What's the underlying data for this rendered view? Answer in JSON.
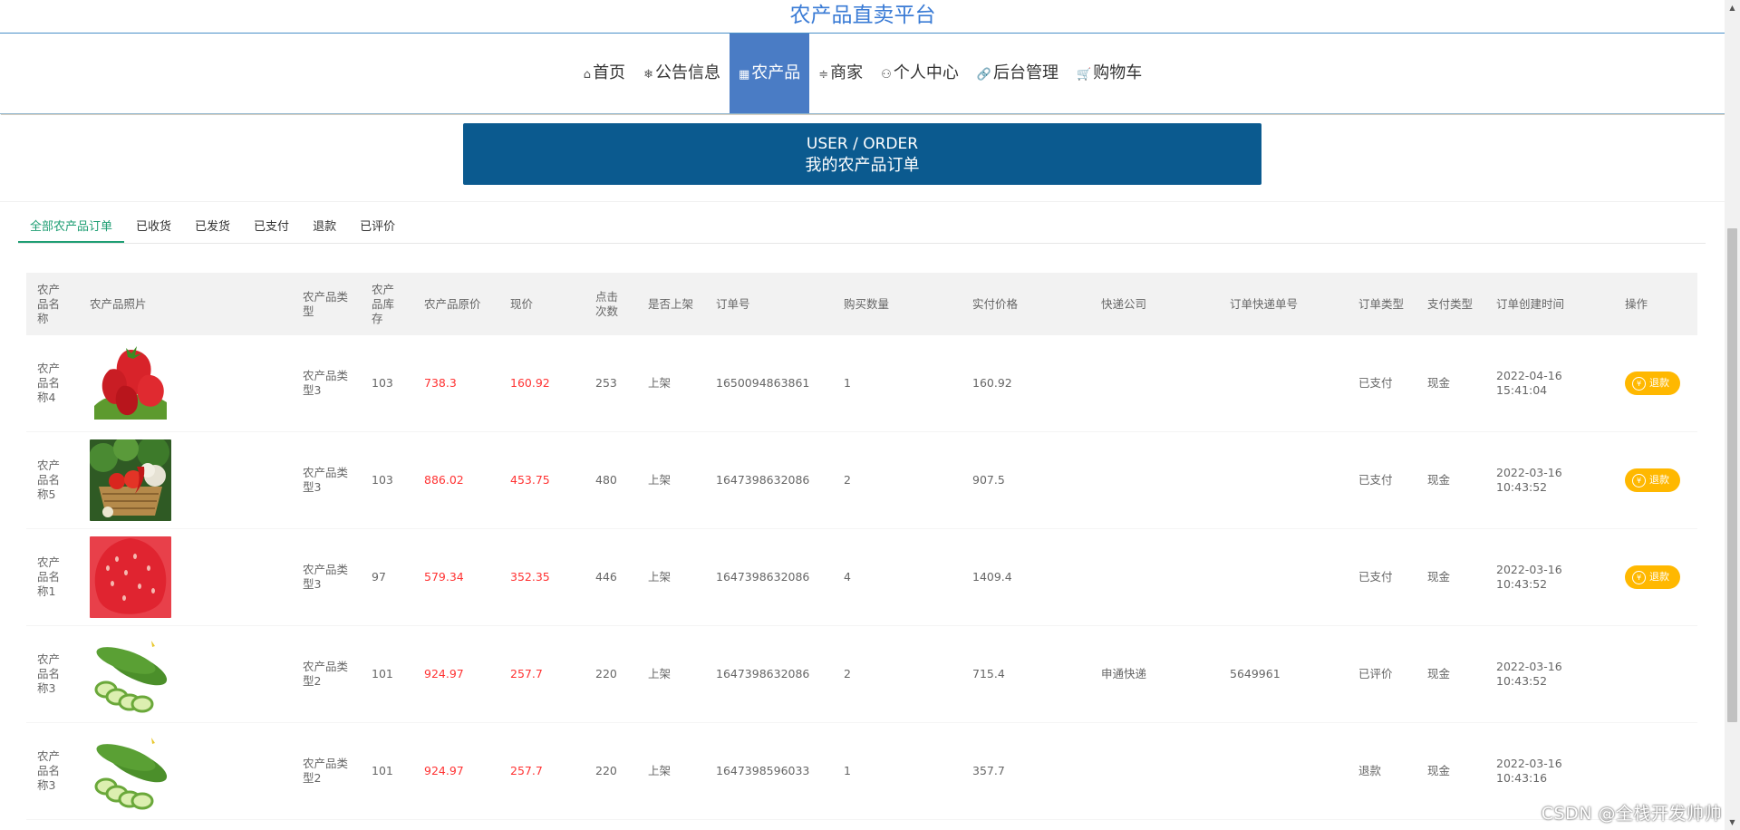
{
  "site": {
    "title": "农产品直卖平台"
  },
  "nav": [
    {
      "icon": "home-icon",
      "glyph": "⌂",
      "label": "首页",
      "active": false
    },
    {
      "icon": "snowflake-icon",
      "glyph": "❄",
      "label": "公告信息",
      "active": false
    },
    {
      "icon": "product-icon",
      "glyph": "▦",
      "label": "农产品",
      "active": true
    },
    {
      "icon": "sliders-icon",
      "glyph": "≑",
      "label": "商家",
      "active": false
    },
    {
      "icon": "user-icon",
      "glyph": "⚇",
      "label": "个人中心",
      "active": false
    },
    {
      "icon": "link-icon",
      "glyph": "🔗",
      "label": "后台管理",
      "active": false
    },
    {
      "icon": "cart-icon",
      "glyph": "🛒",
      "label": "购物车",
      "active": false
    }
  ],
  "banner": {
    "en": "USER / ORDER",
    "cn": "我的农产品订单"
  },
  "tabs": [
    "全部农产品订单",
    "已收货",
    "已发货",
    "已支付",
    "退款",
    "已评价"
  ],
  "table": {
    "headers": [
      "农产品名称",
      "农产品照片",
      "农产品类型",
      "农产品库存",
      "农产品原价",
      "现价",
      "点击次数",
      "是否上架",
      "订单号",
      "购买数量",
      "实付价格",
      "快递公司",
      "订单快递单号",
      "订单类型",
      "支付类型",
      "订单创建时间",
      "操作"
    ],
    "action_label": "退款",
    "rows": [
      {
        "name": "农产品名称4",
        "photo": "strawberries",
        "type": "农产品类型3",
        "stock": "103",
        "orig_price": "738.3",
        "price": "160.92",
        "clicks": "253",
        "listed": "上架",
        "order_no": "1650094863861",
        "qty": "1",
        "paid": "160.92",
        "courier": "",
        "tracking": "",
        "status": "已支付",
        "pay_type": "现金",
        "created": "2022-04-16 15:41:04",
        "refundable": true
      },
      {
        "name": "农产品名称5",
        "photo": "vegetable-basket",
        "type": "农产品类型3",
        "stock": "103",
        "orig_price": "886.02",
        "price": "453.75",
        "clicks": "480",
        "listed": "上架",
        "order_no": "1647398632086",
        "qty": "2",
        "paid": "907.5",
        "courier": "",
        "tracking": "",
        "status": "已支付",
        "pay_type": "现金",
        "created": "2022-03-16 10:43:52",
        "refundable": true
      },
      {
        "name": "农产品名称1",
        "photo": "strawberry-closeup",
        "type": "农产品类型3",
        "stock": "97",
        "orig_price": "579.34",
        "price": "352.35",
        "clicks": "446",
        "listed": "上架",
        "order_no": "1647398632086",
        "qty": "4",
        "paid": "1409.4",
        "courier": "",
        "tracking": "",
        "status": "已支付",
        "pay_type": "现金",
        "created": "2022-03-16 10:43:52",
        "refundable": true
      },
      {
        "name": "农产品名称3",
        "photo": "cucumbers",
        "type": "农产品类型2",
        "stock": "101",
        "orig_price": "924.97",
        "price": "257.7",
        "clicks": "220",
        "listed": "上架",
        "order_no": "1647398632086",
        "qty": "2",
        "paid": "715.4",
        "courier": "申通快递",
        "tracking": "5649961",
        "status": "已评价",
        "pay_type": "现金",
        "created": "2022-03-16 10:43:52",
        "refundable": false
      },
      {
        "name": "农产品名称3",
        "photo": "cucumbers",
        "type": "农产品类型2",
        "stock": "101",
        "orig_price": "924.97",
        "price": "257.7",
        "clicks": "220",
        "listed": "上架",
        "order_no": "1647398596033",
        "qty": "1",
        "paid": "357.7",
        "courier": "",
        "tracking": "",
        "status": "退款",
        "pay_type": "现金",
        "created": "2022-03-16 10:43:16",
        "refundable": false
      }
    ]
  },
  "watermark": "CSDN @全栈开发帅帅",
  "colors": {
    "accent": "#4a7cc5",
    "banner": "#0b5a8f",
    "tab_active": "#1e9e73",
    "price": "#ff3333",
    "refund_button": "#ffb800"
  }
}
